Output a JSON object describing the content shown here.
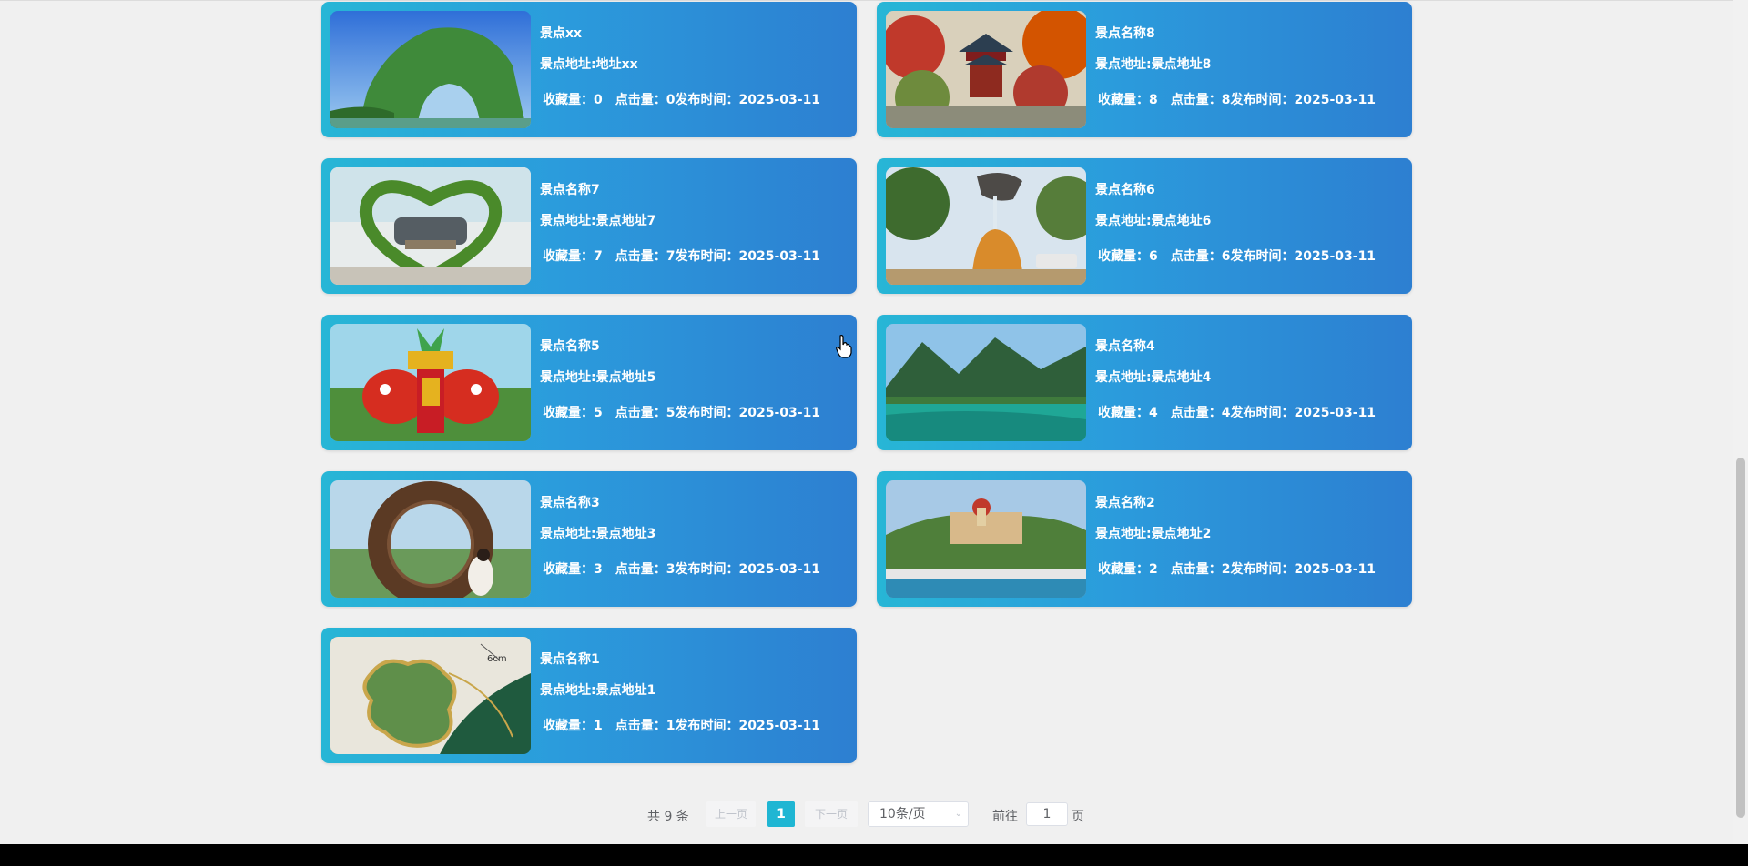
{
  "cards": [
    {
      "name": "景点xx",
      "address": "景点地址:地址xx",
      "fav_label": "收藏量：",
      "fav": "0",
      "click_label": "点击量：",
      "clicks": "0",
      "date_label": "发布时间：",
      "date": "2025-03-11",
      "image": "elephant-trunk-hill"
    },
    {
      "name": "景点名称8",
      "address": "景点地址:景点地址8",
      "fav_label": "收藏量：",
      "fav": "8",
      "click_label": "点击量：",
      "clicks": "8",
      "date_label": "发布时间：",
      "date": "2025-03-11",
      "image": "pavilion-autumn"
    },
    {
      "name": "景点名称7",
      "address": "景点地址:景点地址7",
      "fav_label": "收藏量：",
      "fav": "7",
      "click_label": "点击量：",
      "clicks": "7",
      "date_label": "发布时间：",
      "date": "2025-03-11",
      "image": "heart-arch-sofa"
    },
    {
      "name": "景点名称6",
      "address": "景点地址:景点地址6",
      "fav_label": "收藏量：",
      "fav": "6",
      "click_label": "点击量：",
      "clicks": "6",
      "date_label": "发布时间：",
      "date": "2025-03-11",
      "image": "teapot-rock-fountain"
    },
    {
      "name": "景点名称5",
      "address": "景点地址:景点地址5",
      "fav_label": "收藏量：",
      "fav": "5",
      "click_label": "点击量：",
      "clicks": "5",
      "date_label": "发布时间：",
      "date": "2025-03-11",
      "image": "red-fish-sculpture"
    },
    {
      "name": "景点名称4",
      "address": "景点地址:景点地址4",
      "fav_label": "收藏量：",
      "fav": "4",
      "click_label": "点击量：",
      "clicks": "4",
      "date_label": "发布时间：",
      "date": "2025-03-11",
      "image": "green-lake-mountains"
    },
    {
      "name": "景点名称3",
      "address": "景点地址:景点地址3",
      "fav_label": "收藏量：",
      "fav": "3",
      "click_label": "点击量：",
      "clicks": "3",
      "date_label": "发布时间：",
      "date": "2025-03-11",
      "image": "woven-nest-arch"
    },
    {
      "name": "景点名称2",
      "address": "景点地址:景点地址2",
      "fav_label": "收藏量：",
      "fav": "2",
      "click_label": "点击量：",
      "clicks": "2",
      "date_label": "发布时间：",
      "date": "2025-03-11",
      "image": "hillside-town-river"
    },
    {
      "name": "景点名称1",
      "address": "景点地址:景点地址1",
      "fav_label": "收藏量：",
      "fav": "1",
      "click_label": "点击量：",
      "clicks": "1",
      "date_label": "发布时间：",
      "date": "2025-03-11",
      "image": "gold-bookmark-6cm"
    }
  ],
  "image_caption_6cm": "6cm",
  "pagination": {
    "total": "共 9 条",
    "prev": "上一页",
    "current_page": "1",
    "next": "下一页",
    "page_size": "10条/页",
    "goto_label": "前往",
    "goto_value": "1",
    "page_suffix": "页"
  },
  "colors": {
    "card_start": "#27b6d6",
    "card_end": "#2d7fd1",
    "active_page": "#1fb6d3"
  }
}
